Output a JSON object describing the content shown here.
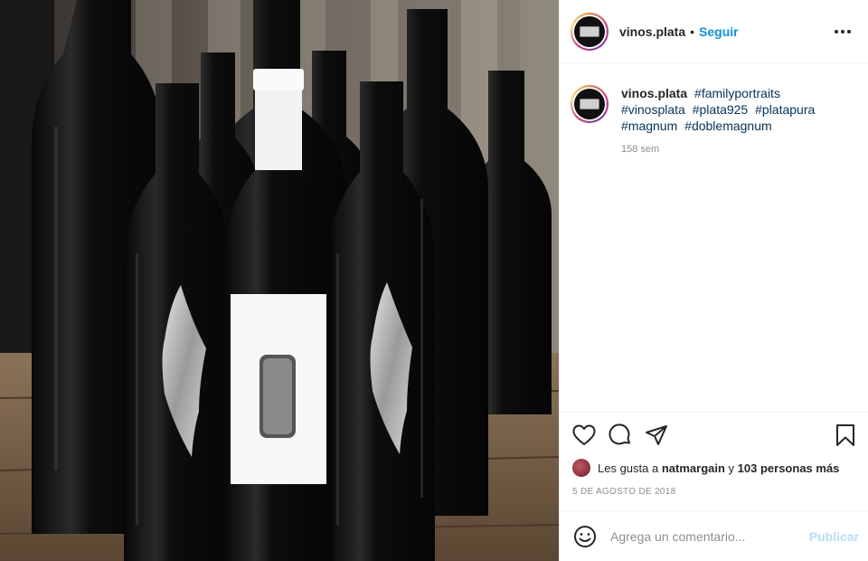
{
  "post": {
    "username": "vinos.plata",
    "follow_label": "Seguir",
    "separator": "•",
    "more_icon": "more-horizontal-icon"
  },
  "caption": {
    "username": "vinos.plata",
    "hashtags": [
      "#familyportraits",
      "#vinosplata",
      "#plata925",
      "#platapura",
      "#magnum",
      "#doblemagnum"
    ],
    "time_ago": "158 sem"
  },
  "actions": {
    "icons": [
      "heart-icon",
      "comment-icon",
      "share-icon",
      "bookmark-icon"
    ]
  },
  "likes": {
    "prefix": "Les gusta a",
    "user": "natmargain",
    "connector": "y",
    "others": "103 personas más"
  },
  "date": "5 DE AGOSTO DE 2018",
  "comment_box": {
    "placeholder": "Agrega un comentario...",
    "publish_label": "Publicar"
  },
  "colors": {
    "link_blue": "#0095f6",
    "hashtag": "#00376b",
    "muted": "#8e8e8e",
    "publish_disabled": "#b2dffc"
  }
}
